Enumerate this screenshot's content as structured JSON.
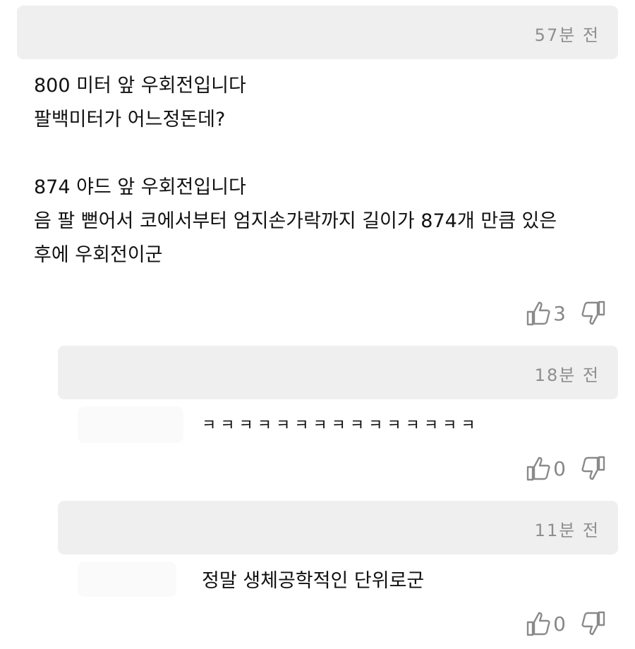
{
  "comments": [
    {
      "time": "57분 전",
      "body": "800 미터 앞 우회전입니다\n팔백미터가 어느정돈데?\n\n874 야드 앞 우회전입니다\n음 팔 뻗어서 코에서부터 엄지손가락까지 길이가 874개 만큼 있은\n후에 우회전이군",
      "likes": "3"
    },
    {
      "time": "18분 전",
      "body": "ㅋㅋㅋㅋㅋㅋㅋㅋㅋㅋㅋㅋㅋㅋㅋ",
      "likes": "0"
    },
    {
      "time": "11분 전",
      "body": "정말 생체공학적인 단위로군",
      "likes": "0"
    }
  ],
  "icons": {
    "like": "thumbs-up-icon",
    "dislike": "thumbs-down-icon"
  },
  "colors": {
    "header_bg": "#efefef",
    "time_text": "#8e8e8e",
    "icon_gray": "#888888"
  }
}
